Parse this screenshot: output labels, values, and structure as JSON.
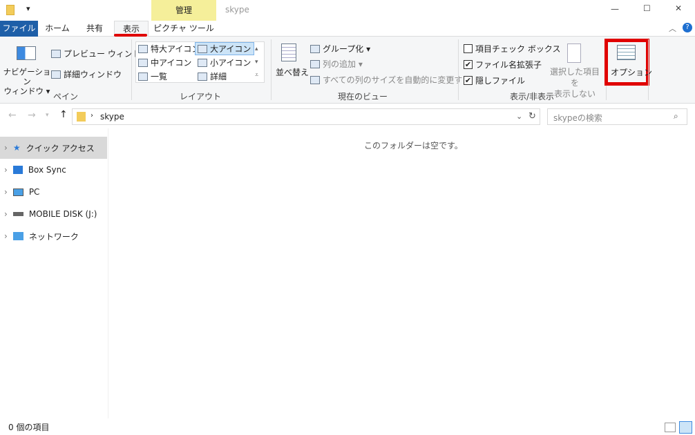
{
  "title": {
    "context_tab": "管理",
    "folder": "skype",
    "minimize": "—",
    "maximize": "☐",
    "close": "✕"
  },
  "tabs": {
    "file": "ファイル",
    "home": "ホーム",
    "share": "共有",
    "view": "表示",
    "picture_tools": "ピクチャ ツール"
  },
  "ribbon": {
    "pane": {
      "navigation": "ナビゲーション",
      "navigation2": "ウィンドウ ▾",
      "preview": "プレビュー ウィンドウ",
      "details": "詳細ウィンドウ",
      "label": "ペイン"
    },
    "layout": {
      "items": [
        "特大アイコン",
        "大アイコン",
        "中アイコン",
        "小アイコン",
        "一覧",
        "詳細"
      ],
      "selected": "大アイコン",
      "label": "レイアウト"
    },
    "current_view": {
      "sort": "並べ替え",
      "group": "グループ化 ▾",
      "add_column": "列の追加 ▾",
      "autosize": "すべての列のサイズを自動的に変更する",
      "label": "現在のビュー"
    },
    "show_hide": {
      "item_checkbox": "項目チェック ボックス",
      "item_checkbox_checked": false,
      "extensions": "ファイル名拡張子",
      "extensions_checked": true,
      "hidden": "隠しファイル",
      "hidden_checked": true,
      "hide_selected1": "選択した項目を",
      "hide_selected2": "表示しない",
      "label": "表示/非表示"
    },
    "options": "オプション"
  },
  "address": {
    "path": "skype",
    "search_placeholder": "skypeの検索"
  },
  "nav": [
    "クイック アクセス",
    "Box Sync",
    "PC",
    "MOBILE DISK (J:)",
    "ネットワーク"
  ],
  "content": {
    "empty": "このフォルダーは空です。"
  },
  "status": {
    "count": "0 個の項目"
  },
  "colors": {
    "file_tab": "#1e5fa8",
    "context": "#f5ef9a",
    "highlight": "#e00000"
  }
}
